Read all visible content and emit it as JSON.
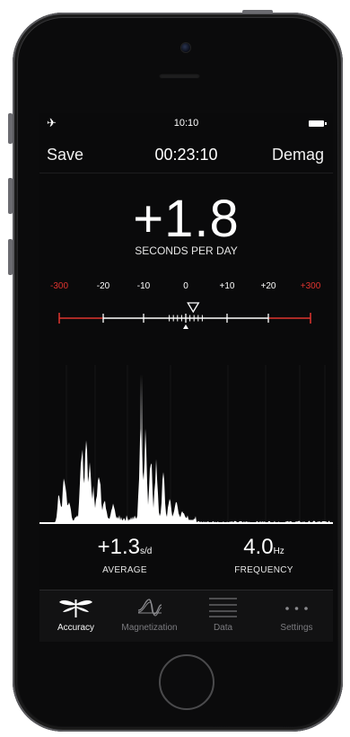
{
  "status_bar": {
    "time": "10:10",
    "airplane_icon": "airplane-icon"
  },
  "nav": {
    "left_button": "Save",
    "timer": "00:23:10",
    "right_button": "Demag"
  },
  "reading": {
    "value": "+1.8",
    "unit": "SECONDS PER DAY"
  },
  "scale": {
    "labels": [
      "-300",
      "-20",
      "-10",
      "0",
      "+10",
      "+20",
      "+300"
    ],
    "red_labels": [
      "-300",
      "+300"
    ],
    "indicator_value": 1.8
  },
  "stats": {
    "average": {
      "value": "+1.3",
      "unit": "s/d",
      "label": "AVERAGE"
    },
    "frequency": {
      "value": "4.0",
      "unit": "Hz",
      "label": "FREQUENCY"
    }
  },
  "tabs": [
    {
      "label": "Accuracy",
      "icon": "dragonfly-icon",
      "active": true
    },
    {
      "label": "Magnetization",
      "icon": "waveform-icon",
      "active": false
    },
    {
      "label": "Data",
      "icon": "list-lines-icon",
      "active": false
    },
    {
      "label": "Settings",
      "icon": "more-dots-icon",
      "active": false
    }
  ],
  "colors": {
    "red_scale": "#e0342f",
    "background": "#0a0a0b",
    "text": "#ffffff"
  }
}
